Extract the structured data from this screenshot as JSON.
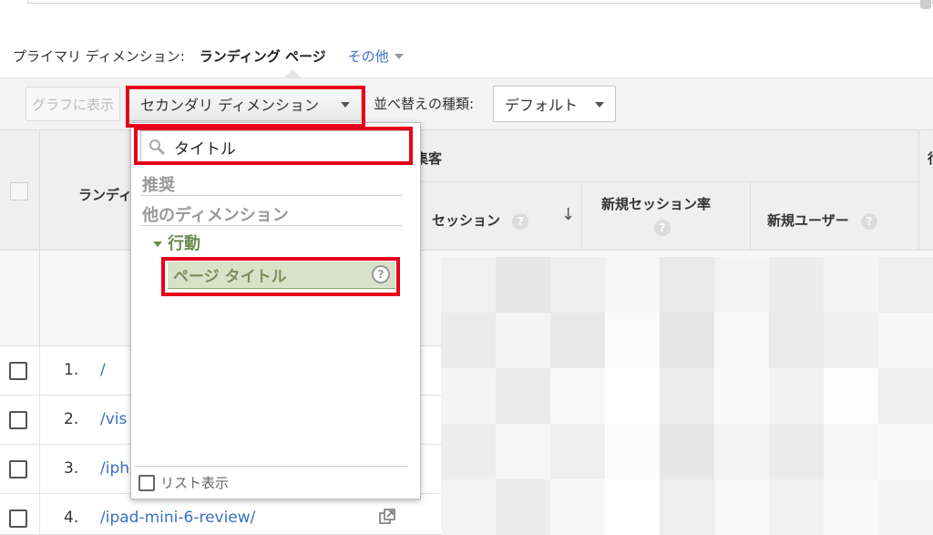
{
  "primary": {
    "label": "プライマリ ディメンション:",
    "value": "ランディング ページ",
    "other": "その他"
  },
  "toolbar": {
    "graph_button": "グラフに表示",
    "secondary_button": "セカンダリ ディメンション",
    "sort_label": "並べ替えの種類:",
    "sort_value": "デフォルト"
  },
  "table": {
    "landing_header": "ランディ",
    "group_header": "集客",
    "behavior_header": "行",
    "metrics": [
      "セッション",
      "新規セッション率",
      "新規ユーザー"
    ],
    "help_glyph": "?",
    "sort_arrow": "↓",
    "rows": [
      {
        "num": "1.",
        "link": "/"
      },
      {
        "num": "2.",
        "link": "/vis"
      },
      {
        "num": "3.",
        "link": "/iph"
      },
      {
        "num": "4.",
        "link": "/ipad-mini-6-review/"
      }
    ]
  },
  "dropdown": {
    "search_value": "タイトル",
    "section_recommended": "推奨",
    "section_other": "他のディメンション",
    "group_label": "行動",
    "item_label": "ページ タイトル",
    "help_glyph": "?",
    "footer_label": "リスト表示"
  },
  "colors": {
    "highlight_box": "#e8001c",
    "link": "#3a6fc1",
    "selected_item_bg": "#d8e2c8",
    "group_text": "#6c8a4e"
  }
}
